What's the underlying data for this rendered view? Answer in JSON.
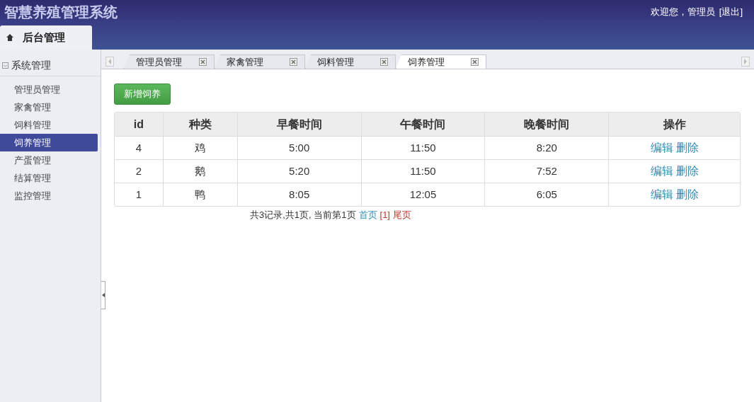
{
  "header": {
    "title": "智慧养殖管理系统",
    "welcome": "欢迎您，管理员",
    "logout": "[退出]"
  },
  "top_tab": {
    "label": "后台管理"
  },
  "sidebar": {
    "group": "系统管理",
    "items": [
      {
        "label": "管理员管理",
        "selected": false
      },
      {
        "label": "家禽管理",
        "selected": false
      },
      {
        "label": "饲料管理",
        "selected": false
      },
      {
        "label": "饲养管理",
        "selected": true
      },
      {
        "label": "产蛋管理",
        "selected": false
      },
      {
        "label": "结算管理",
        "selected": false
      },
      {
        "label": "监控管理",
        "selected": false
      }
    ]
  },
  "tabs": [
    {
      "label": "管理员管理",
      "selected": false
    },
    {
      "label": "家禽管理",
      "selected": false
    },
    {
      "label": "饲料管理",
      "selected": false
    },
    {
      "label": "饲养管理",
      "selected": true
    }
  ],
  "add_button": "新增饲养",
  "table": {
    "columns": [
      "id",
      "种类",
      "早餐时间",
      "午餐时间",
      "晚餐时间",
      "操作"
    ],
    "rows": [
      {
        "cells": [
          "4",
          "鸡",
          "5:00",
          "11:50",
          "8:20"
        ],
        "actions": [
          "编辑",
          "删除"
        ]
      },
      {
        "cells": [
          "2",
          "鹅",
          "5:20",
          "11:50",
          "7:52"
        ],
        "actions": [
          "编辑",
          "删除"
        ]
      },
      {
        "cells": [
          "1",
          "鸭",
          "8:05",
          "12:05",
          "6:05"
        ],
        "actions": [
          "编辑",
          "删除"
        ]
      }
    ]
  },
  "pager": {
    "summary": "共3记录,共1页, 当前第1页",
    "links": [
      {
        "label": "首页",
        "color": "#2a8bb5"
      },
      {
        "label": "[1]",
        "color": "#c0392b"
      },
      {
        "label": "尾页",
        "color": "#c0392b"
      }
    ]
  }
}
